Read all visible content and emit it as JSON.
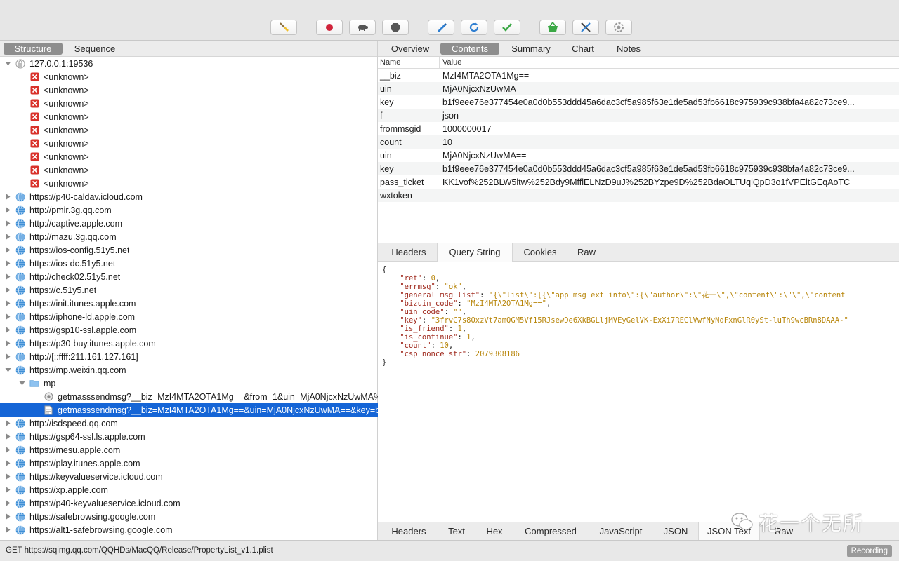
{
  "colors": {
    "selection": "#1565d6",
    "error_icon": "#d9322b",
    "globe_icon": "#3f8fd6",
    "json_key": "#a02b1f",
    "json_value": "#b8860b"
  },
  "toolbar": {
    "buttons": [
      {
        "name": "broom-icon"
      },
      {
        "name": "record-icon"
      },
      {
        "name": "turtle-throttle-icon"
      },
      {
        "name": "stop-icon"
      },
      {
        "name": "pen-compose-icon"
      },
      {
        "name": "repeat-icon"
      },
      {
        "name": "validate-checkmark-icon"
      },
      {
        "name": "basket-icon"
      },
      {
        "name": "tools-icon"
      },
      {
        "name": "settings-gear-icon"
      }
    ]
  },
  "left_panel": {
    "tabs": [
      "Structure",
      "Sequence"
    ],
    "active_tab": "Structure",
    "tree": [
      {
        "label": "127.0.0.1:19536",
        "indent": 0,
        "expanded": true,
        "icon": "lock-host-icon"
      },
      {
        "label": "<unknown>",
        "indent": 1,
        "icon": "error-icon"
      },
      {
        "label": "<unknown>",
        "indent": 1,
        "icon": "error-icon"
      },
      {
        "label": "<unknown>",
        "indent": 1,
        "icon": "error-icon"
      },
      {
        "label": "<unknown>",
        "indent": 1,
        "icon": "error-icon"
      },
      {
        "label": "<unknown>",
        "indent": 1,
        "icon": "error-icon"
      },
      {
        "label": "<unknown>",
        "indent": 1,
        "icon": "error-icon"
      },
      {
        "label": "<unknown>",
        "indent": 1,
        "icon": "error-icon"
      },
      {
        "label": "<unknown>",
        "indent": 1,
        "icon": "error-icon"
      },
      {
        "label": "<unknown>",
        "indent": 1,
        "icon": "error-icon"
      },
      {
        "label": "https://p40-caldav.icloud.com",
        "indent": 0,
        "expanded": false,
        "icon": "globe-icon"
      },
      {
        "label": "http://pmir.3g.qq.com",
        "indent": 0,
        "expanded": false,
        "icon": "globe-icon"
      },
      {
        "label": "http://captive.apple.com",
        "indent": 0,
        "expanded": false,
        "icon": "globe-icon"
      },
      {
        "label": "http://mazu.3g.qq.com",
        "indent": 0,
        "expanded": false,
        "icon": "globe-icon"
      },
      {
        "label": "https://ios-config.51y5.net",
        "indent": 0,
        "expanded": false,
        "icon": "globe-icon"
      },
      {
        "label": "https://ios-dc.51y5.net",
        "indent": 0,
        "expanded": false,
        "icon": "globe-icon"
      },
      {
        "label": "http://check02.51y5.net",
        "indent": 0,
        "expanded": false,
        "icon": "globe-icon"
      },
      {
        "label": "https://c.51y5.net",
        "indent": 0,
        "expanded": false,
        "icon": "globe-icon"
      },
      {
        "label": "https://init.itunes.apple.com",
        "indent": 0,
        "expanded": false,
        "icon": "globe-icon"
      },
      {
        "label": "https://iphone-ld.apple.com",
        "indent": 0,
        "expanded": false,
        "icon": "globe-icon"
      },
      {
        "label": "https://gsp10-ssl.apple.com",
        "indent": 0,
        "expanded": false,
        "icon": "globe-icon"
      },
      {
        "label": "https://p30-buy.itunes.apple.com",
        "indent": 0,
        "expanded": false,
        "icon": "globe-icon"
      },
      {
        "label": "http://[::ffff:211.161.127.161]",
        "indent": 0,
        "expanded": false,
        "icon": "globe-icon"
      },
      {
        "label": "https://mp.weixin.qq.com",
        "indent": 0,
        "expanded": true,
        "icon": "globe-icon"
      },
      {
        "label": "mp",
        "indent": 1,
        "expanded": true,
        "icon": "folder-icon"
      },
      {
        "label": "getmasssendmsg?__biz=MzI4MTA2OTA1Mg==&from=1&uin=MjA0NjcxNzUwMA%",
        "indent": 2,
        "icon": "request-icon"
      },
      {
        "label": "getmasssendmsg?__biz=MzI4MTA2OTA1Mg==&uin=MjA0NjcxNzUwMA==&key=b",
        "indent": 2,
        "icon": "document-icon",
        "selected": true
      },
      {
        "label": "http://isdspeed.qq.com",
        "indent": 0,
        "expanded": false,
        "icon": "globe-icon"
      },
      {
        "label": "https://gsp64-ssl.ls.apple.com",
        "indent": 0,
        "expanded": false,
        "icon": "globe-icon"
      },
      {
        "label": "https://mesu.apple.com",
        "indent": 0,
        "expanded": false,
        "icon": "globe-icon"
      },
      {
        "label": "https://play.itunes.apple.com",
        "indent": 0,
        "expanded": false,
        "icon": "globe-icon"
      },
      {
        "label": "https://keyvalueservice.icloud.com",
        "indent": 0,
        "expanded": false,
        "icon": "globe-icon"
      },
      {
        "label": "https://xp.apple.com",
        "indent": 0,
        "expanded": false,
        "icon": "globe-icon"
      },
      {
        "label": "https://p40-keyvalueservice.icloud.com",
        "indent": 0,
        "expanded": false,
        "icon": "globe-icon"
      },
      {
        "label": "https://safebrowsing.google.com",
        "indent": 0,
        "expanded": false,
        "icon": "globe-icon"
      },
      {
        "label": "https://alt1-safebrowsing.google.com",
        "indent": 0,
        "expanded": false,
        "icon": "globe-icon"
      }
    ]
  },
  "right_panel": {
    "tabs": [
      "Overview",
      "Contents",
      "Summary",
      "Chart",
      "Notes"
    ],
    "active_tab": "Contents",
    "params_headers": [
      "Name",
      "Value"
    ],
    "params": [
      {
        "name": "__biz",
        "value": "MzI4MTA2OTA1Mg=="
      },
      {
        "name": "uin",
        "value": "MjA0NjcxNzUwMA=="
      },
      {
        "name": "key",
        "value": "b1f9eee76e377454e0a0d0b553ddd45a6dac3cf5a985f63e1de5ad53fb6618c975939c938bfa4a82c73ce9..."
      },
      {
        "name": "f",
        "value": "json"
      },
      {
        "name": "frommsgid",
        "value": "1000000017"
      },
      {
        "name": "count",
        "value": "10"
      },
      {
        "name": "uin",
        "value": "MjA0NjcxNzUwMA=="
      },
      {
        "name": "key",
        "value": "b1f9eee76e377454e0a0d0b553ddd45a6dac3cf5a985f63e1de5ad53fb6618c975939c938bfa4a82c73ce9..."
      },
      {
        "name": "pass_ticket",
        "value": "KK1vof%252BLW5ltw%252Bdy9MfflELNzD9uJ%252BYzpe9D%252BdaOLTUqlQpD3o1fVPEltGEqAoTC"
      },
      {
        "name": "wxtoken",
        "value": ""
      }
    ],
    "sub_tabs": [
      "Headers",
      "Query String",
      "Cookies",
      "Raw"
    ],
    "active_sub_tab": "Query String",
    "json_open": "{",
    "json_close": "}",
    "json_lines": [
      {
        "key": "\"ret\"",
        "value": "0",
        "comma": true
      },
      {
        "key": "\"errmsg\"",
        "value": "\"ok\"",
        "comma": true
      },
      {
        "key": "\"general_msg_list\"",
        "value": "\"{\\\"list\\\":[{\\\"app_msg_ext_info\\\":{\\\"author\\\":\\\"花一\\\",\\\"content\\\":\\\"\\\",\\\"content_",
        "comma": false
      },
      {
        "key": "\"bizuin_code\"",
        "value": "\"MzI4MTA2OTA1Mg==\"",
        "comma": true
      },
      {
        "key": "\"uin_code\"",
        "value": "\"\"",
        "comma": true
      },
      {
        "key": "\"key\"",
        "value": "\"3frvC7s8OxzVt7amQGM5Vf15RJsewDe6XkBGLljMVEyGelVK-ExXi7REClVwfNyNqFxnGlR0ySt-luTh9wcBRn8DAAA-\"",
        "comma": false
      },
      {
        "key": "\"is_friend\"",
        "value": "1",
        "comma": true
      },
      {
        "key": "\"is_continue\"",
        "value": "1",
        "comma": true
      },
      {
        "key": "\"count\"",
        "value": "10",
        "comma": true
      },
      {
        "key": "\"csp_nonce_str\"",
        "value": "2079308186",
        "comma": false
      }
    ],
    "bottom_tabs": [
      "Headers",
      "Text",
      "Hex",
      "Compressed",
      "JavaScript",
      "JSON",
      "JSON Text",
      "Raw"
    ],
    "active_bottom_tab": "JSON Text"
  },
  "watermark": {
    "text": "花一个无所"
  },
  "status_bar": {
    "text": "GET https://sqimg.qq.com/QQHDs/MacQQ/Release/PropertyList_v1.1.plist",
    "badge": "Recording"
  }
}
